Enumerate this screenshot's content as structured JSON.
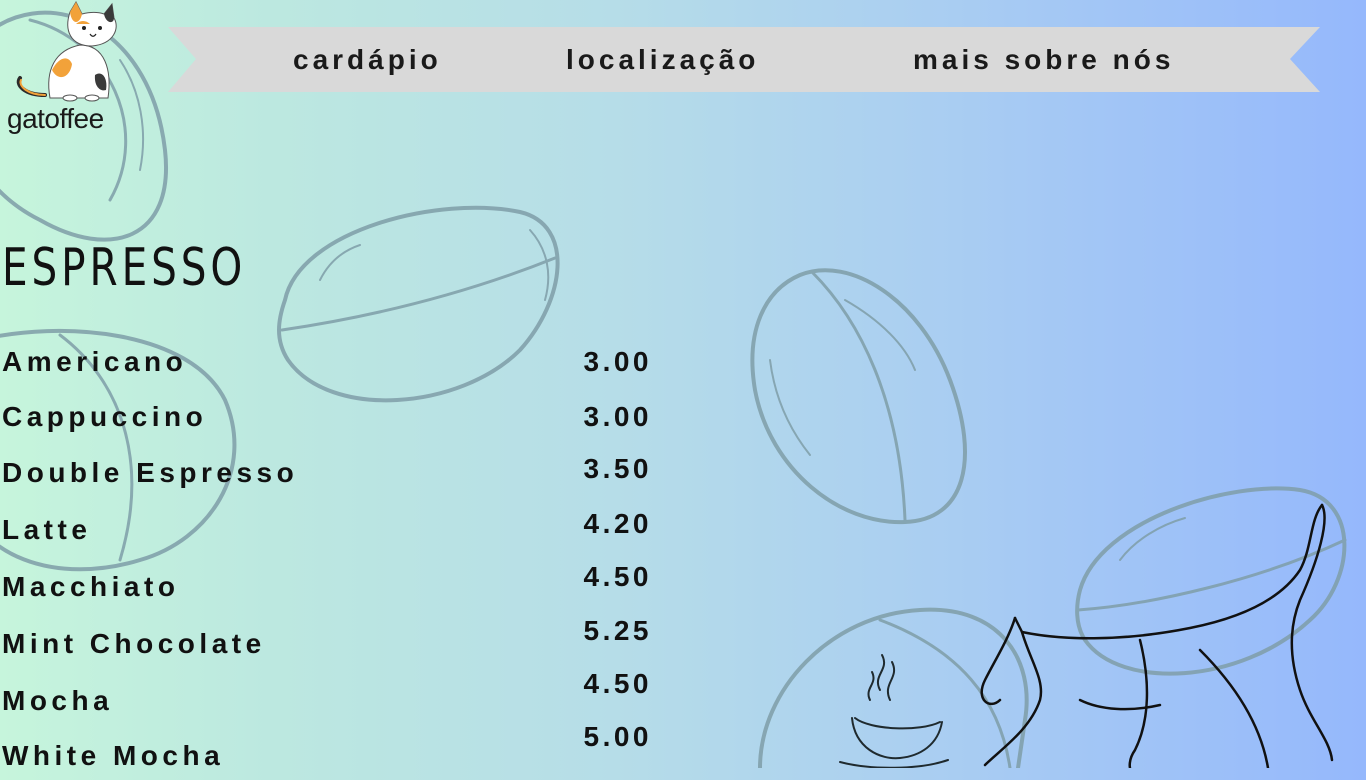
{
  "brand": {
    "name": "gatoffee",
    "logo_icon": "calico-cat-icon"
  },
  "nav": {
    "items": [
      {
        "label": "cardápio"
      },
      {
        "label": "localização"
      },
      {
        "label": "mais sobre nós"
      }
    ]
  },
  "menu": {
    "section_title": "ESPRESSO",
    "items": [
      {
        "name": "Americano",
        "price": "3.00"
      },
      {
        "name": "Cappuccino",
        "price": "3.00"
      },
      {
        "name": "Double Espresso",
        "price": "3.50"
      },
      {
        "name": "Latte",
        "price": "4.20"
      },
      {
        "name": "Macchiato",
        "price": "4.50"
      },
      {
        "name": "Mint Chocolate",
        "price": "5.25"
      },
      {
        "name": "Mocha",
        "price": "4.50"
      },
      {
        "name": "White Mocha",
        "price": "5.00"
      }
    ]
  },
  "decor": {
    "icons": [
      "coffee-bean-icon",
      "coffee-cup-icon",
      "walking-cat-outline-icon"
    ]
  },
  "colors": {
    "gradient_left": "#c6f5dc",
    "gradient_right": "#95b8fc",
    "ribbon": "#d9d9d9",
    "text": "#111111",
    "bean_stroke": "#7a9aa6"
  }
}
